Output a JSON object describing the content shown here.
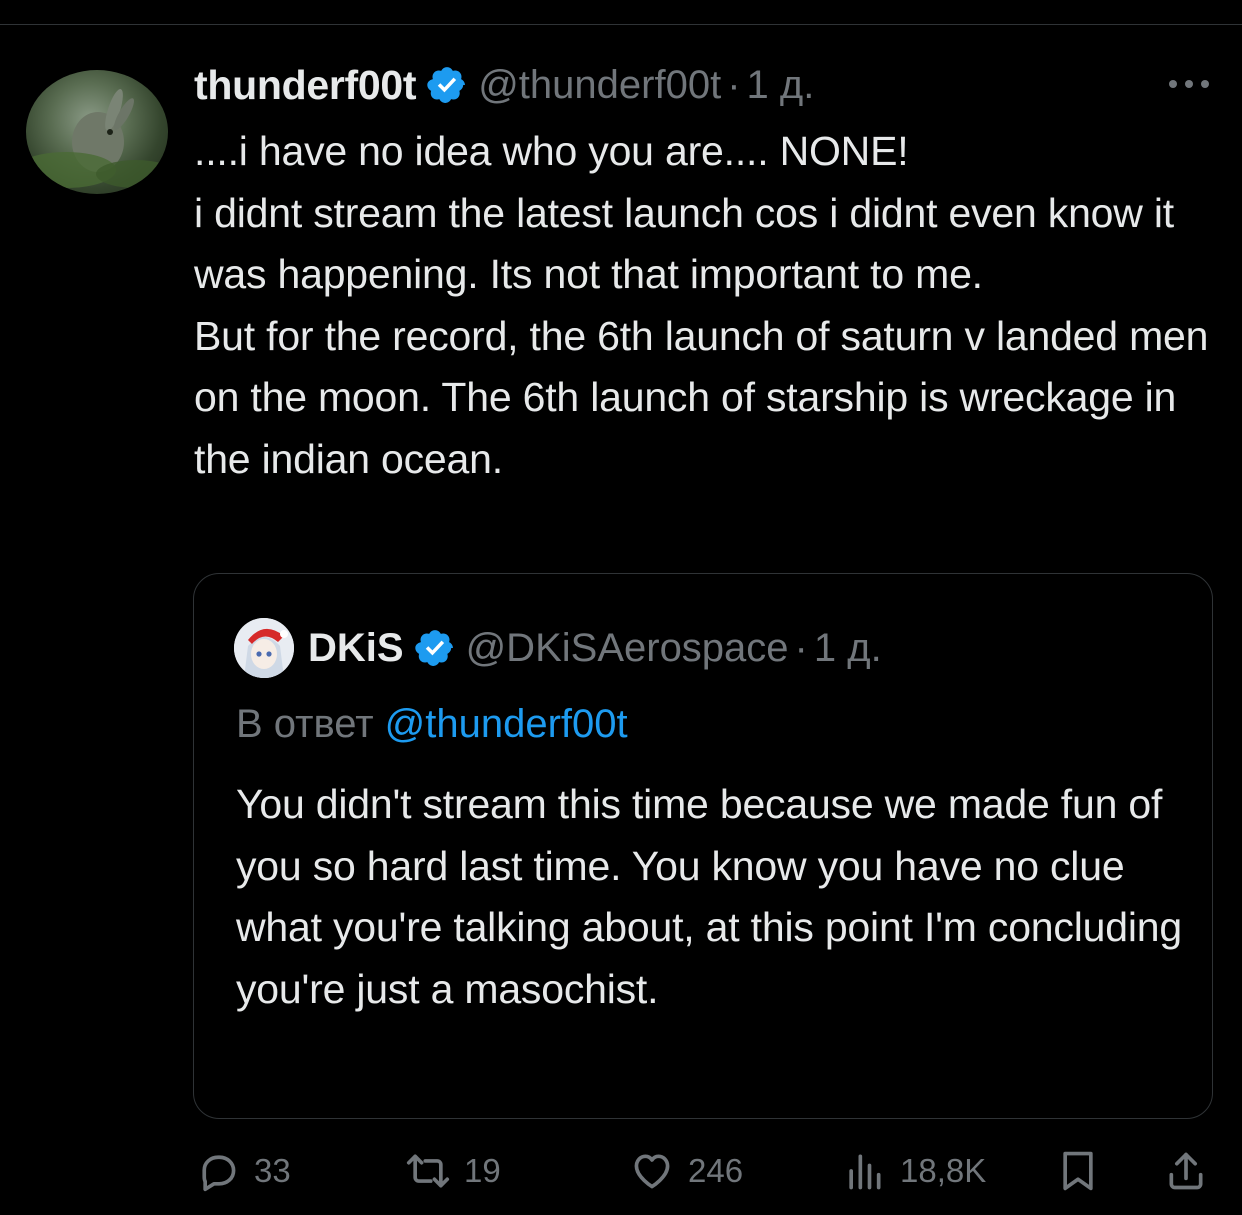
{
  "tweet": {
    "display_name": "thunderf00t",
    "handle": "@thunderf00t",
    "separator": "·",
    "time": "1 д.",
    "text": "....i have no idea who you are.... NONE!\ni didnt stream the latest launch cos i didnt even know it was happening. Its not that important to me.\nBut for the record, the 6th launch of saturn v landed men on the moon.  The 6th launch of starship is wreckage in the indian ocean."
  },
  "quote": {
    "display_name": "DKiS",
    "handle": "@DKiSAerospace",
    "separator": "·",
    "time": "1 д.",
    "reply_prefix": "В ответ",
    "reply_mention": "@thunderf00t",
    "text": "You didn't stream this time because we made fun of you so hard last time. You know you have no clue what you're talking about, at this point I'm concluding you're just a masochist."
  },
  "actions": {
    "replies": "33",
    "reposts": "19",
    "likes": "246",
    "views": "18,8K"
  },
  "icons": {
    "verified": "verified-badge-icon",
    "more": "more-horizontal-icon",
    "reply": "reply-bubble-icon",
    "repost": "repost-icon",
    "like": "heart-icon",
    "views": "views-bar-chart-icon",
    "bookmark": "bookmark-icon",
    "share": "share-icon"
  },
  "colors": {
    "background": "#000000",
    "text": "#e7e9ea",
    "secondary": "#71767b",
    "accent": "#1d9bf0",
    "border": "#2f3336"
  }
}
